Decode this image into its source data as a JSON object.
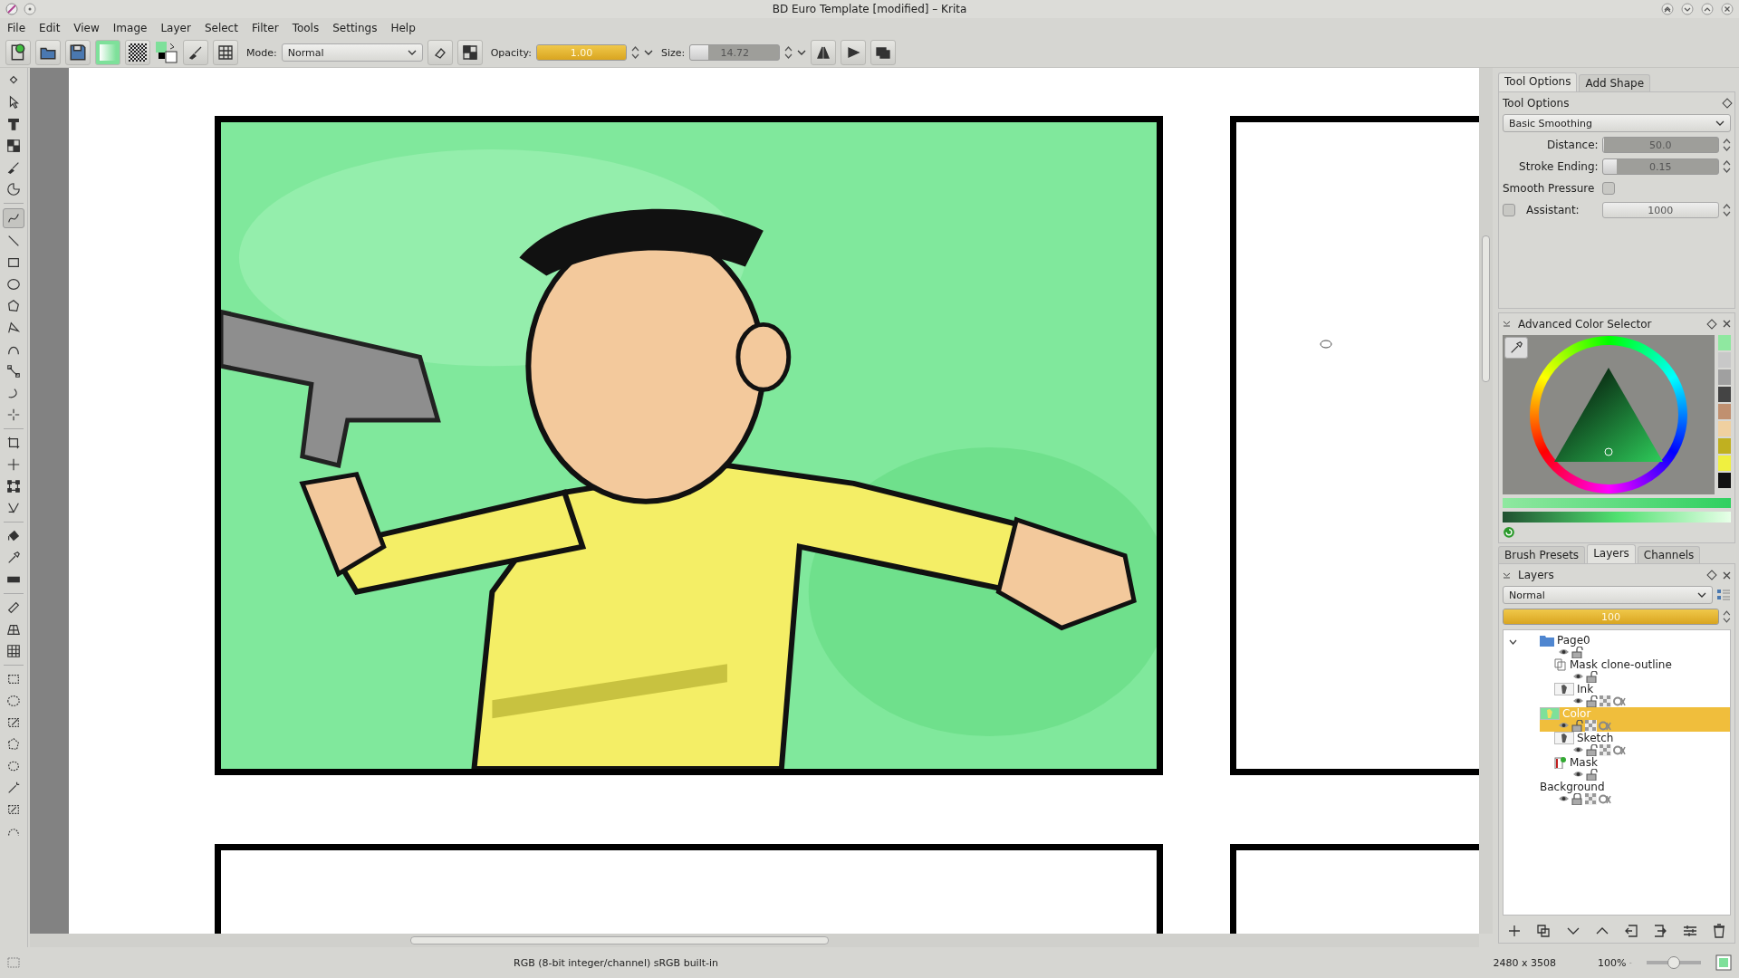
{
  "window": {
    "title": "BD Euro Template [modified] – Krita"
  },
  "menu": [
    "File",
    "Edit",
    "View",
    "Image",
    "Layer",
    "Select",
    "Filter",
    "Tools",
    "Settings",
    "Help"
  ],
  "toolbar": {
    "mode_label": "Mode:",
    "mode": "Normal",
    "opacity_label": "Opacity:",
    "opacity": {
      "value": "1.00",
      "level": 1.0
    },
    "size_label": "Size:",
    "size": {
      "value": "14.72",
      "level": 0.2
    }
  },
  "dock_tabs_top": [
    {
      "label": "Tool Options",
      "selected": true
    },
    {
      "label": "Add Shape",
      "selected": false
    }
  ],
  "tool_options": {
    "title": "Tool Options",
    "smoothing": "Basic Smoothing",
    "distance": {
      "label": "Distance:",
      "value": "50.0",
      "level": 0.0
    },
    "stroke_ending": {
      "label": "Stroke Ending:",
      "value": "0.15",
      "level": 0.12
    },
    "smooth_pressure": {
      "label": "Smooth Pressure",
      "checked": false
    },
    "assistant": {
      "label": "Assistant:",
      "checked": false,
      "value": "1000"
    }
  },
  "color_selector": {
    "title": "Advanced Color Selector"
  },
  "dock_tabs_bottom": [
    {
      "label": "Brush Presets",
      "selected": false
    },
    {
      "label": "Layers",
      "selected": true
    },
    {
      "label": "Channels",
      "selected": false
    }
  ],
  "layers_panel": {
    "title": "Layers",
    "blend_mode": "Normal",
    "opacity": {
      "value": "100",
      "level": 1.0
    },
    "layers": [
      {
        "name": "Page0",
        "kind": "group",
        "expanded": true,
        "selected": false,
        "locked": false,
        "children": [
          {
            "name": "Mask clone-outline",
            "kind": "clone",
            "selected": false,
            "locked": false
          },
          {
            "name": "Ink",
            "kind": "paint",
            "selected": false,
            "locked": false
          },
          {
            "name": "Color",
            "kind": "paint",
            "selected": true,
            "locked": false
          },
          {
            "name": "Sketch",
            "kind": "paint",
            "selected": false,
            "locked": false
          },
          {
            "name": "Mask",
            "kind": "mask",
            "selected": false,
            "locked": false
          }
        ]
      },
      {
        "name": "Background",
        "kind": "plain",
        "selected": false,
        "locked": true
      }
    ]
  },
  "status_bar": {
    "color_space": "RGB (8-bit integer/channel)  sRGB built-in",
    "dimensions": "2480 x 3508",
    "zoom": "100%",
    "zoom_slider": {
      "level": 0.5
    }
  }
}
